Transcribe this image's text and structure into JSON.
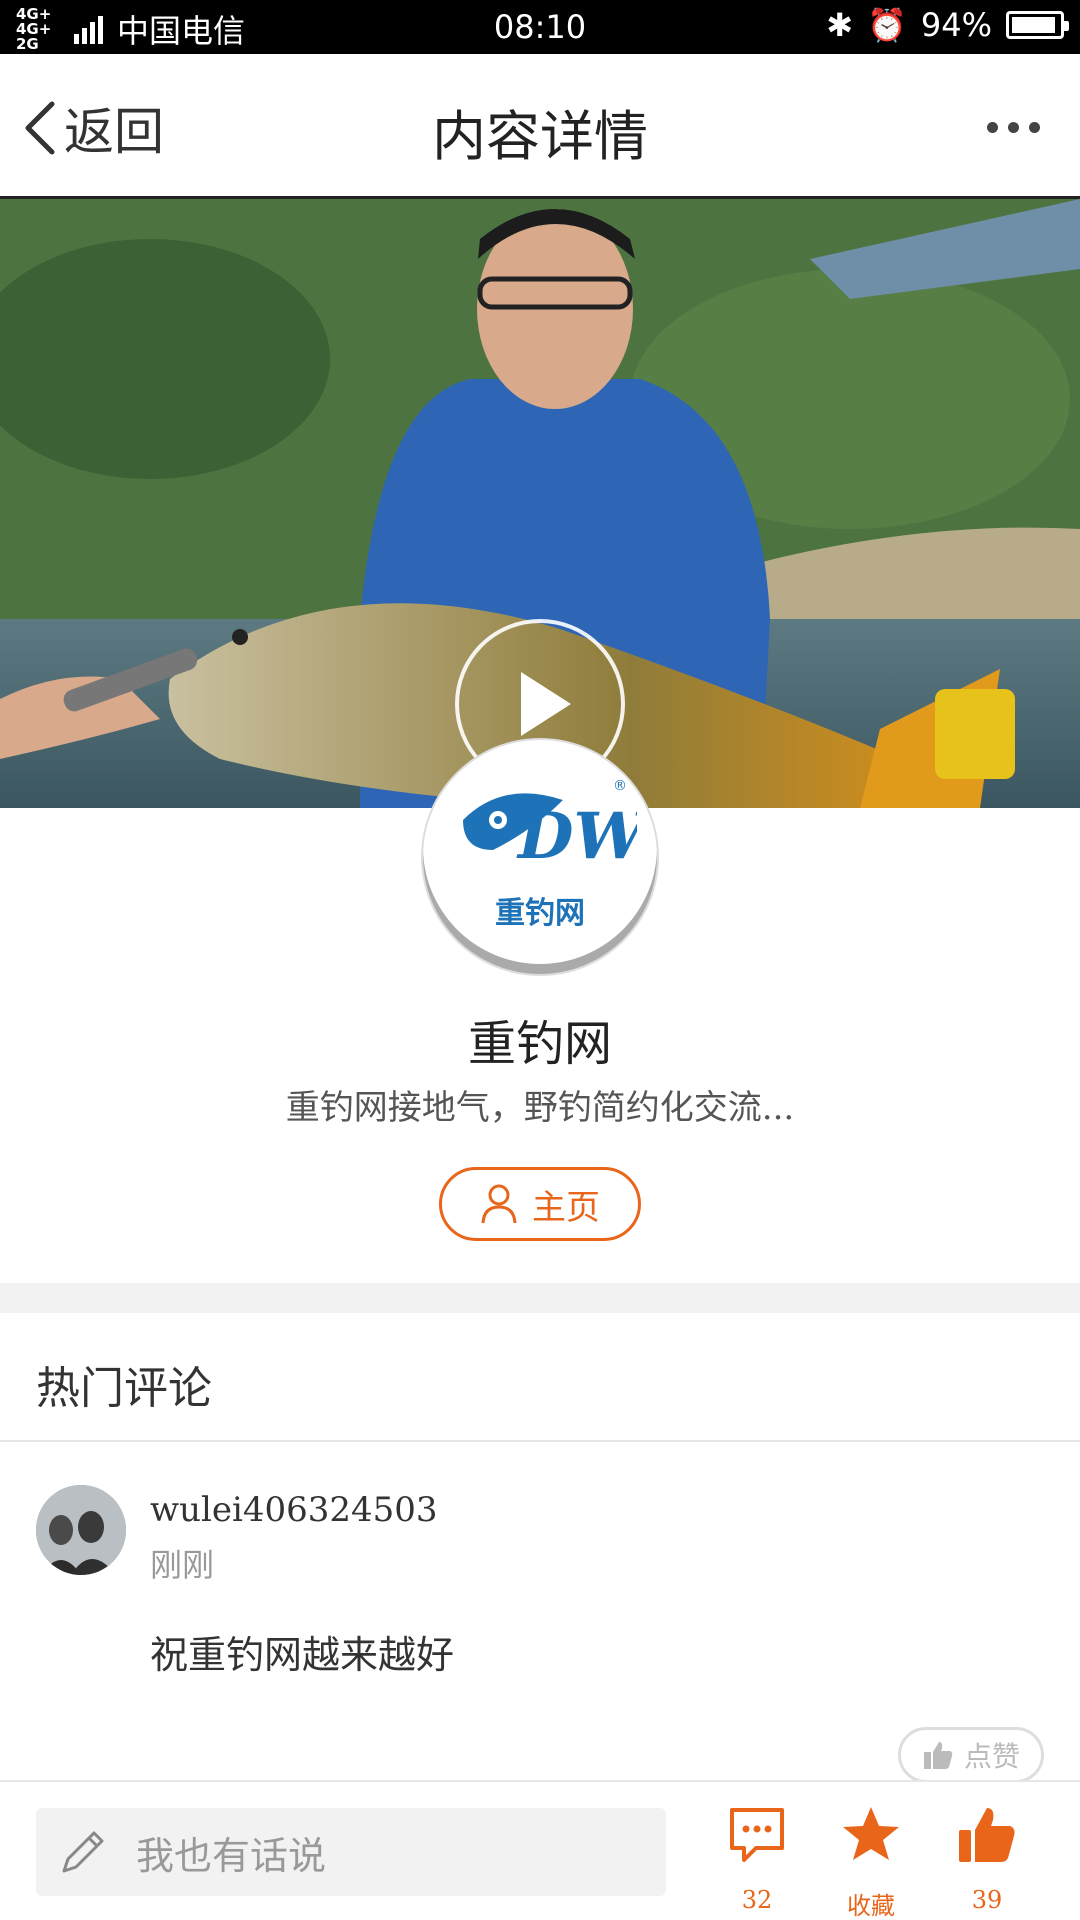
{
  "status_bar": {
    "network_label": "4G+ 4G+ 2G",
    "carrier": "中国电信",
    "time": "08:10",
    "battery": "94%",
    "battery_level": 0.94,
    "icons": [
      "bluetooth-icon",
      "alarm-icon"
    ]
  },
  "nav": {
    "back_label": "返回",
    "title": "内容详情",
    "more_icon": "more-dots-icon"
  },
  "video": {
    "play_icon": "play-icon"
  },
  "channel": {
    "logo_text": "重钓网",
    "name": "重钓网",
    "description": "重钓网接地气，野钓简约化交流...",
    "home_button_label": "主页"
  },
  "comments": {
    "section_title": "热门评论",
    "items": [
      {
        "username": "wulei406324503",
        "time": "刚刚",
        "text": "祝重钓网越来越好",
        "like_label": "点赞"
      }
    ]
  },
  "bottom_bar": {
    "input_placeholder": "我也有话说",
    "comment_count": "32",
    "favorite_label": "收藏",
    "like_count": "39"
  },
  "colors": {
    "accent": "#e8651a",
    "brand_blue": "#1e73b8",
    "gray_text": "#999999"
  }
}
